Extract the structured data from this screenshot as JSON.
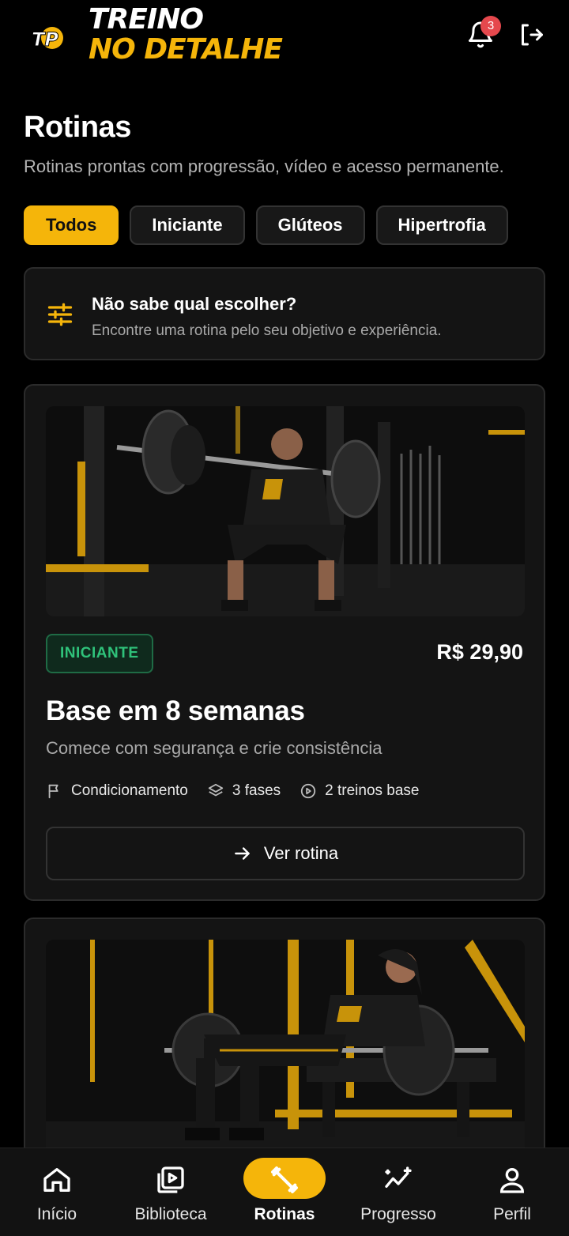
{
  "brand": {
    "line1": "TREINO",
    "line2": "NO DETALHE",
    "monogram": "TP"
  },
  "header": {
    "notification_count": "3"
  },
  "page": {
    "title": "Rotinas",
    "subtitle": "Rotinas prontas com progressão, vídeo e acesso permanente."
  },
  "filters": [
    {
      "label": "Todos",
      "active": true
    },
    {
      "label": "Iniciante",
      "active": false
    },
    {
      "label": "Glúteos",
      "active": false
    },
    {
      "label": "Hipertrofia",
      "active": false
    }
  ],
  "helper": {
    "title": "Não sabe qual escolher?",
    "subtitle": "Encontre uma rotina pelo seu objetivo e experiência.",
    "icon": "sliders-icon"
  },
  "routines": [
    {
      "level": "INICIANTE",
      "price": "R$ 29,90",
      "title": "Base em 8 semanas",
      "subtitle": "Comece com segurança e crie consistência",
      "meta": [
        "Condicionamento",
        "3 fases",
        "2 treinos base"
      ],
      "button": "Ver rotina",
      "image": "man-barbell-squat-photo"
    },
    {
      "image": "woman-hip-thrust-photo"
    }
  ],
  "nav": [
    {
      "label": "Início",
      "icon": "home-icon",
      "active": false
    },
    {
      "label": "Biblioteca",
      "icon": "video-library-icon",
      "active": false
    },
    {
      "label": "Rotinas",
      "icon": "dumbbell-icon",
      "active": true
    },
    {
      "label": "Progresso",
      "icon": "progress-chart-icon",
      "active": false
    },
    {
      "label": "Perfil",
      "icon": "user-icon",
      "active": false
    }
  ],
  "colors": {
    "accent": "#f5b50a",
    "level_green": "#2fc27a",
    "badge_red": "#e5484d",
    "background": "#000000",
    "card": "#141414"
  }
}
